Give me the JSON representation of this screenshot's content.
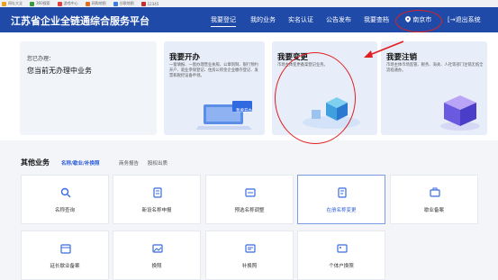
{
  "bookmarks": [
    {
      "label": "网址大全",
      "color": "#e8a020"
    },
    {
      "label": "360搜索",
      "color": "#3a9b3a"
    },
    {
      "label": "游戏中心",
      "color": "#e34040"
    },
    {
      "label": "网购地图",
      "color": "#e07020"
    },
    {
      "label": "谷歌地图",
      "color": "#3a7be0"
    },
    {
      "label": "12345",
      "color": "#c03030"
    }
  ],
  "header": {
    "title": "江苏省企业全链通综合服务平台",
    "nav": [
      "我要登记",
      "我的业务",
      "实名认证",
      "公告发布",
      "我要查档"
    ],
    "location": "南京市",
    "logout": "退出系统",
    "accent": "#1f4aa8"
  },
  "hero": {
    "pending_label": "您已办理：",
    "pending_text": "您当前无办理中业务",
    "cards": [
      {
        "title": "我要开办",
        "desc": "一窗填报、一窗办理营业执照、公章刻制、银行预约开户、就业参保登记、住房公积金企业缴存登记、发票和税控设备申领。",
        "banner": "我要开办"
      },
      {
        "title": "我要变更",
        "desc": "市场主体变更备案登记业务。"
      },
      {
        "title": "我要注销",
        "desc": "市场主体市场监管、税务、海关、人社等部门注销无纸全流程通办。"
      }
    ]
  },
  "other": {
    "title": "其他业务",
    "tabs": [
      "名称/歇业/补换照",
      "商务报告",
      "股权出质"
    ],
    "tiles": [
      "名称查询",
      "新设名称申报",
      "预选名称调整",
      "在册名称变更",
      "歇业备案",
      "延长歇业备案",
      "换照",
      "补换照",
      "个体户换照"
    ]
  }
}
